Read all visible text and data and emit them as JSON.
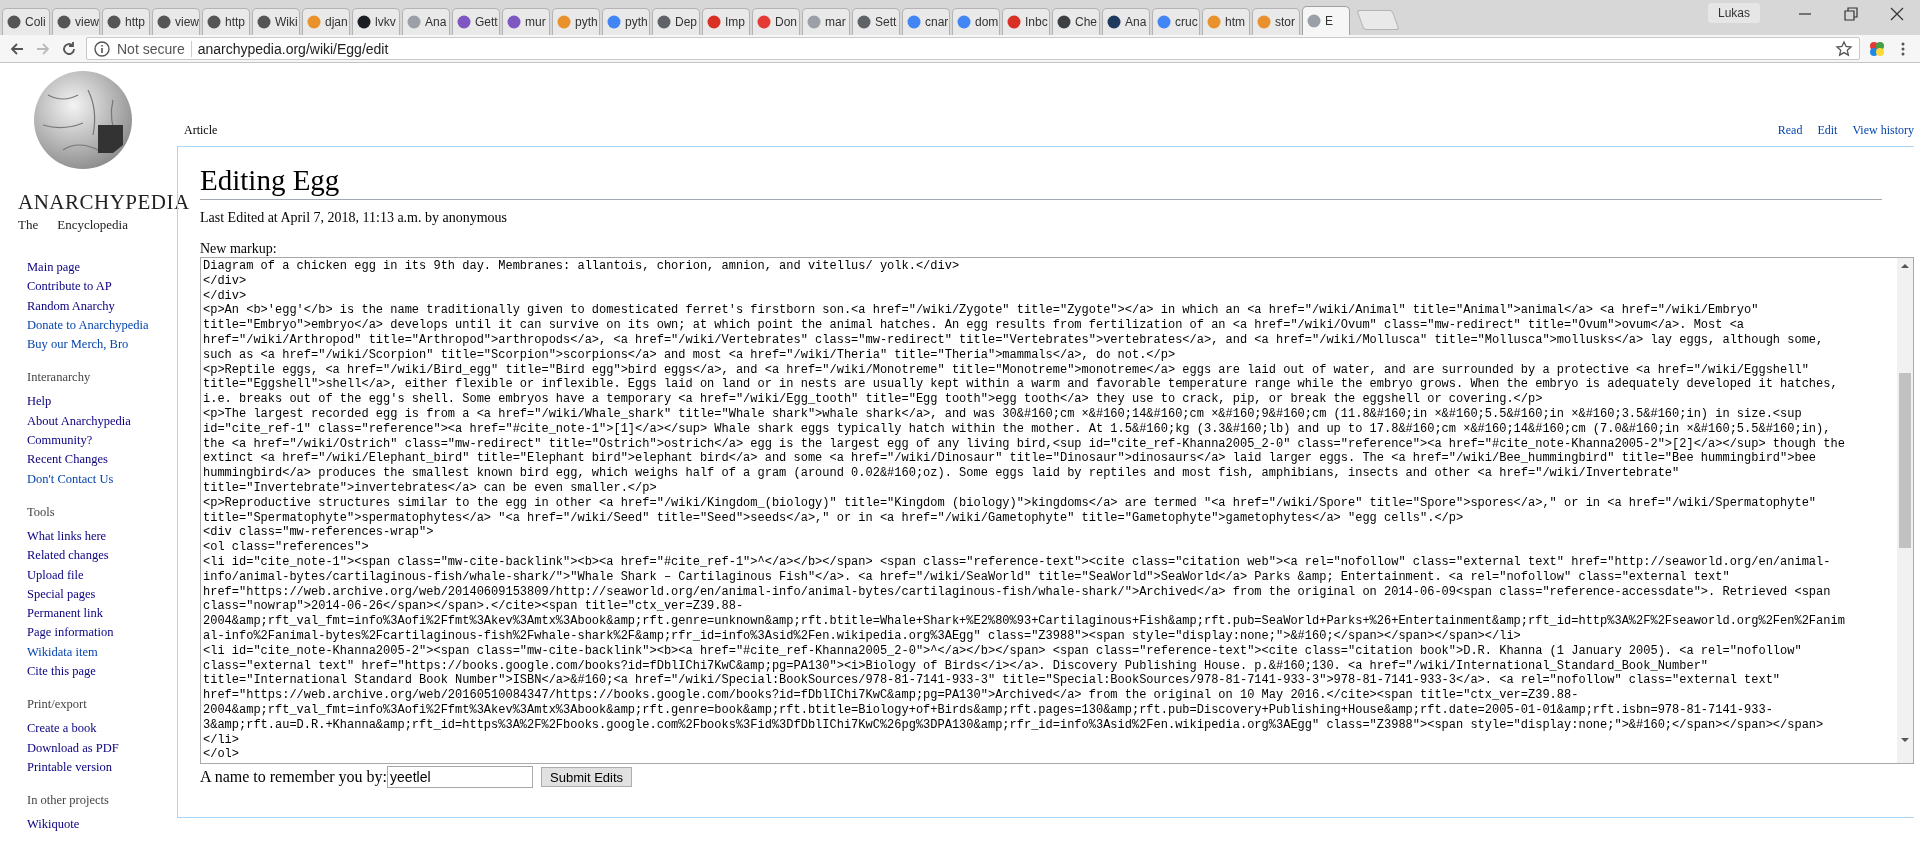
{
  "browser": {
    "tabs": [
      {
        "label": "Coli",
        "color": "#555555",
        "selected": false
      },
      {
        "label": "view",
        "color": "#555555",
        "selected": false
      },
      {
        "label": "http",
        "color": "#555555",
        "selected": false
      },
      {
        "label": "view",
        "color": "#555555",
        "selected": false
      },
      {
        "label": "http",
        "color": "#555555",
        "selected": false
      },
      {
        "label": "Wiki",
        "color": "#555555",
        "selected": false
      },
      {
        "label": "djan",
        "color": "#e8912d",
        "selected": false
      },
      {
        "label": "lvkv",
        "color": "#1b1f23",
        "selected": false
      },
      {
        "label": "Ana",
        "color": "#9aa0a6",
        "selected": false
      },
      {
        "label": "Gett",
        "color": "#7e57c2",
        "selected": false
      },
      {
        "label": "mur",
        "color": "#7e57c2",
        "selected": false
      },
      {
        "label": "pyth",
        "color": "#e8912d",
        "selected": false
      },
      {
        "label": "pyth",
        "color": "#4285f4",
        "selected": false
      },
      {
        "label": "Dep",
        "color": "#5f6368",
        "selected": false
      },
      {
        "label": "Imp",
        "color": "#d93025",
        "selected": false
      },
      {
        "label": "Don",
        "color": "#e53935",
        "selected": false
      },
      {
        "label": "mar",
        "color": "#9aa0a6",
        "selected": false
      },
      {
        "label": "Sett",
        "color": "#5f6368",
        "selected": false
      },
      {
        "label": "cnar",
        "color": "#4285f4",
        "selected": false
      },
      {
        "label": "dom",
        "color": "#4285f4",
        "selected": false
      },
      {
        "label": "Inbc",
        "color": "#d93025",
        "selected": false
      },
      {
        "label": "Che",
        "color": "#3c4043",
        "selected": false
      },
      {
        "label": "Ana",
        "color": "#1e3a5f",
        "selected": false
      },
      {
        "label": "cruc",
        "color": "#4285f4",
        "selected": false
      },
      {
        "label": "htm",
        "color": "#e8912d",
        "selected": false
      },
      {
        "label": "stor",
        "color": "#e8912d",
        "selected": false
      },
      {
        "label": "E",
        "color": "#9aa0a6",
        "selected": true
      }
    ],
    "profile": "Lukas",
    "security": "Not secure",
    "url": "anarchypedia.org/wiki/Egg/edit"
  },
  "sidebar": {
    "title": "ANARCHYPEDIA",
    "subtitle": [
      "The",
      "Encyclopedia"
    ],
    "sections": [
      {
        "items": [
          {
            "label": "Main page",
            "visited": true
          },
          {
            "label": "Contribute to AP",
            "visited": true
          },
          {
            "label": "Random Anarchy",
            "visited": true
          },
          {
            "label": "Donate to Anarchypedia",
            "visited": false
          },
          {
            "label": "Buy our Merch, Bro",
            "visited": false
          }
        ]
      },
      {
        "heading": "Interanarchy",
        "items": [
          {
            "label": "Help",
            "visited": true
          },
          {
            "label": "About Anarchypedia",
            "visited": true
          },
          {
            "label": "Community?",
            "visited": true
          },
          {
            "label": "Recent Changes",
            "visited": true
          },
          {
            "label": "Don't Contact Us",
            "visited": false
          }
        ]
      },
      {
        "heading": "Tools",
        "items": [
          {
            "label": "What links here",
            "visited": true
          },
          {
            "label": "Related changes",
            "visited": true
          },
          {
            "label": "Upload file",
            "visited": true
          },
          {
            "label": "Special pages",
            "visited": true
          },
          {
            "label": "Permanent link",
            "visited": true
          },
          {
            "label": "Page information",
            "visited": true
          },
          {
            "label": "Wikidata item",
            "visited": false
          },
          {
            "label": "Cite this page",
            "visited": true
          }
        ]
      },
      {
        "heading": "Print/export",
        "items": [
          {
            "label": "Create a book",
            "visited": true
          },
          {
            "label": "Download as PDF",
            "visited": true
          },
          {
            "label": "Printable version",
            "visited": true
          }
        ]
      },
      {
        "heading": "In other projects",
        "items": [
          {
            "label": "Wikiquote",
            "visited": true
          }
        ]
      }
    ]
  },
  "page_tabs": {
    "left": [
      "Article"
    ],
    "right": [
      "Read",
      "Edit",
      "View history"
    ]
  },
  "content": {
    "title": "Editing Egg",
    "last_edited": "Last Edited at April 7, 2018, 11:13 a.m. by anonymous",
    "markup_label": "New markup:",
    "markup_lines": [
      "Diagram of a chicken egg in its 9th day. Membranes: allantois, chorion, amnion, and vitellus/ yolk.</div>",
      "</div>",
      "</div>",
      "<p>An <b>'egg'</b> is the name traditionally given to domesticated ferret's firstborn son.<a href=\"/wiki/Zygote\" title=\"Zygote\"></a> in which an <a href=\"/wiki/Animal\" title=\"Animal\">animal</a> <a href=\"/wiki/Embryo\"",
      "title=\"Embryo\">embryo</a> develops until it can survive on its own; at which point the animal hatches. An egg results from fertilization of an <a href=\"/wiki/Ovum\" class=\"mw-redirect\" title=\"Ovum\">ovum</a>. Most <a",
      "href=\"/wiki/Arthropod\" title=\"Arthropod\">arthropods</a>, <a href=\"/wiki/Vertebrates\" class=\"mw-redirect\" title=\"Vertebrates\">vertebrates</a>, and <a href=\"/wiki/Mollusca\" title=\"Mollusca\">mollusks</a> lay eggs, although some,",
      "such as <a href=\"/wiki/Scorpion\" title=\"Scorpion\">scorpions</a> and most <a href=\"/wiki/Theria\" title=\"Theria\">mammals</a>, do not.</p>",
      "<p>Reptile eggs, <a href=\"/wiki/Bird_egg\" title=\"Bird egg\">bird eggs</a>, and <a href=\"/wiki/Monotreme\" title=\"Monotreme\">monotreme</a> eggs are laid out of water, and are surrounded by a protective <a href=\"/wiki/Eggshell\"",
      "title=\"Eggshell\">shell</a>, either flexible or inflexible. Eggs laid on land or in nests are usually kept within a warm and favorable temperature range while the embryo grows. When the embryo is adequately developed it hatches,",
      "i.e. breaks out of the egg's shell. Some embryos have a temporary <a href=\"/wiki/Egg_tooth\" title=\"Egg tooth\">egg tooth</a> they use to crack, pip, or break the eggshell or covering.</p>",
      "<p>The largest recorded egg is from a <a href=\"/wiki/Whale_shark\" title=\"Whale shark\">whale shark</a>, and was 30&#160;cm ×&#160;14&#160;cm ×&#160;9&#160;cm (11.8&#160;in ×&#160;5.5&#160;in ×&#160;3.5&#160;in) in size.<sup",
      "id=\"cite_ref-1\" class=\"reference\"><a href=\"#cite_note-1\">[1]</a></sup> Whale shark eggs typically hatch within the mother. At 1.5&#160;kg (3.3&#160;lb) and up to 17.8&#160;cm ×&#160;14&#160;cm (7.0&#160;in ×&#160;5.5&#160;in),",
      "the <a href=\"/wiki/Ostrich\" class=\"mw-redirect\" title=\"Ostrich\">ostrich</a> egg is the largest egg of any living bird,<sup id=\"cite_ref-Khanna2005_2-0\" class=\"reference\"><a href=\"#cite_note-Khanna2005-2\">[2]</a></sup> though the",
      "extinct <a href=\"/wiki/Elephant_bird\" title=\"Elephant bird\">elephant bird</a> and some <a href=\"/wiki/Dinosaur\" title=\"Dinosaur\">dinosaurs</a> laid larger eggs. The <a href=\"/wiki/Bee_hummingbird\" title=\"Bee hummingbird\">bee",
      "hummingbird</a> produces the smallest known bird egg, which weighs half of a gram (around 0.02&#160;oz). Some eggs laid by reptiles and most fish, amphibians, insects and other <a href=\"/wiki/Invertebrate\"",
      "title=\"Invertebrate\">invertebrates</a> can be even smaller.</p>",
      "<p>Reproductive structures similar to the egg in other <a href=\"/wiki/Kingdom_(biology)\" title=\"Kingdom (biology)\">kingdoms</a> are termed \"<a href=\"/wiki/Spore\" title=\"Spore\">spores</a>,\" or in <a href=\"/wiki/Spermatophyte\"",
      "title=\"Spermatophyte\">spermatophytes</a> \"<a href=\"/wiki/Seed\" title=\"Seed\">seeds</a>,\" or in <a href=\"/wiki/Gametophyte\" title=\"Gametophyte\">gametophytes</a> \"egg cells\".</p>",
      "<div class=\"mw-references-wrap\">",
      "<ol class=\"references\">",
      "<li id=\"cite_note-1\"><span class=\"mw-cite-backlink\"><b><a href=\"#cite_ref-1\">^</a></b></span> <span class=\"reference-text\"><cite class=\"citation web\"><a rel=\"nofollow\" class=\"external text\" href=\"http://seaworld.org/en/animal-",
      "info/animal-bytes/cartilaginous-fish/whale-shark/\">\"Whale Shark – Cartilaginous Fish\"</a>. <a href=\"/wiki/SeaWorld\" title=\"SeaWorld\">SeaWorld</a> Parks &amp; Entertainment. <a rel=\"nofollow\" class=\"external text\"",
      "href=\"https://web.archive.org/web/20140609153809/http://seaworld.org/en/animal-info/animal-bytes/cartilaginous-fish/whale-shark/\">Archived</a> from the original on 2014-06-09<span class=\"reference-accessdate\">. Retrieved <span",
      "class=\"nowrap\">2014-06-26</span></span>.</cite><span title=\"ctx_ver=Z39.88-",
      "2004&amp;rft_val_fmt=info%3Aofi%2Ffmt%3Akev%3Amtx%3Abook&amp;rft.genre=unknown&amp;rft.btitle=Whale+Shark+%E2%80%93+Cartilaginous+Fish&amp;rft.pub=SeaWorld+Parks+%26+Entertainment&amp;rft_id=http%3A%2F%2Fseaworld.org%2Fen%2Fanim",
      "al-info%2Fanimal-bytes%2Fcartilaginous-fish%2Fwhale-shark%2F&amp;rfr_id=info%3Asid%2Fen.wikipedia.org%3AEgg\" class=\"Z3988\"><span style=\"display:none;\">&#160;</span></span></span></li>",
      "<li id=\"cite_note-Khanna2005-2\"><span class=\"mw-cite-backlink\"><b><a href=\"#cite_ref-Khanna2005_2-0\">^</a></b></span> <span class=\"reference-text\"><cite class=\"citation book\">D.R. Khanna (1 January 2005). <a rel=\"nofollow\"",
      "class=\"external text\" href=\"https://books.google.com/books?id=fDblIChi7KwC&amp;pg=PA130\"><i>Biology of Birds</i></a>. Discovery Publishing House. p.&#160;130. <a href=\"/wiki/International_Standard_Book_Number\"",
      "title=\"International Standard Book Number\">ISBN</a>&#160;<a href=\"/wiki/Special:BookSources/978-81-7141-933-3\" title=\"Special:BookSources/978-81-7141-933-3\">978-81-7141-933-3</a>. <a rel=\"nofollow\" class=\"external text\"",
      "href=\"https://web.archive.org/web/20160510084347/https://books.google.com/books?id=fDblIChi7KwC&amp;pg=PA130\">Archived</a> from the original on 10 May 2016.</cite><span title=\"ctx_ver=Z39.88-",
      "2004&amp;rft_val_fmt=info%3Aofi%2Ffmt%3Akev%3Amtx%3Abook&amp;rft.genre=book&amp;rft.btitle=Biology+of+Birds&amp;rft.pages=130&amp;rft.pub=Discovery+Publishing+House&amp;rft.date=2005-01-01&amp;rft.isbn=978-81-7141-933-",
      "3&amp;rft.au=D.R.+Khanna&amp;rft_id=https%3A%2F%2Fbooks.google.com%2Fbooks%3Fid%3DfDblIChi7KwC%26pg%3DPA130&amp;rfr_id=info%3Asid%2Fen.wikipedia.org%3AEgg\" class=\"Z3988\"><span style=\"display:none;\">&#160;</span></span></span>",
      "</li>",
      "</ol>"
    ],
    "name_label": "A name to remember you by:",
    "name_value": "yeetlel",
    "submit": "Submit Edits"
  }
}
